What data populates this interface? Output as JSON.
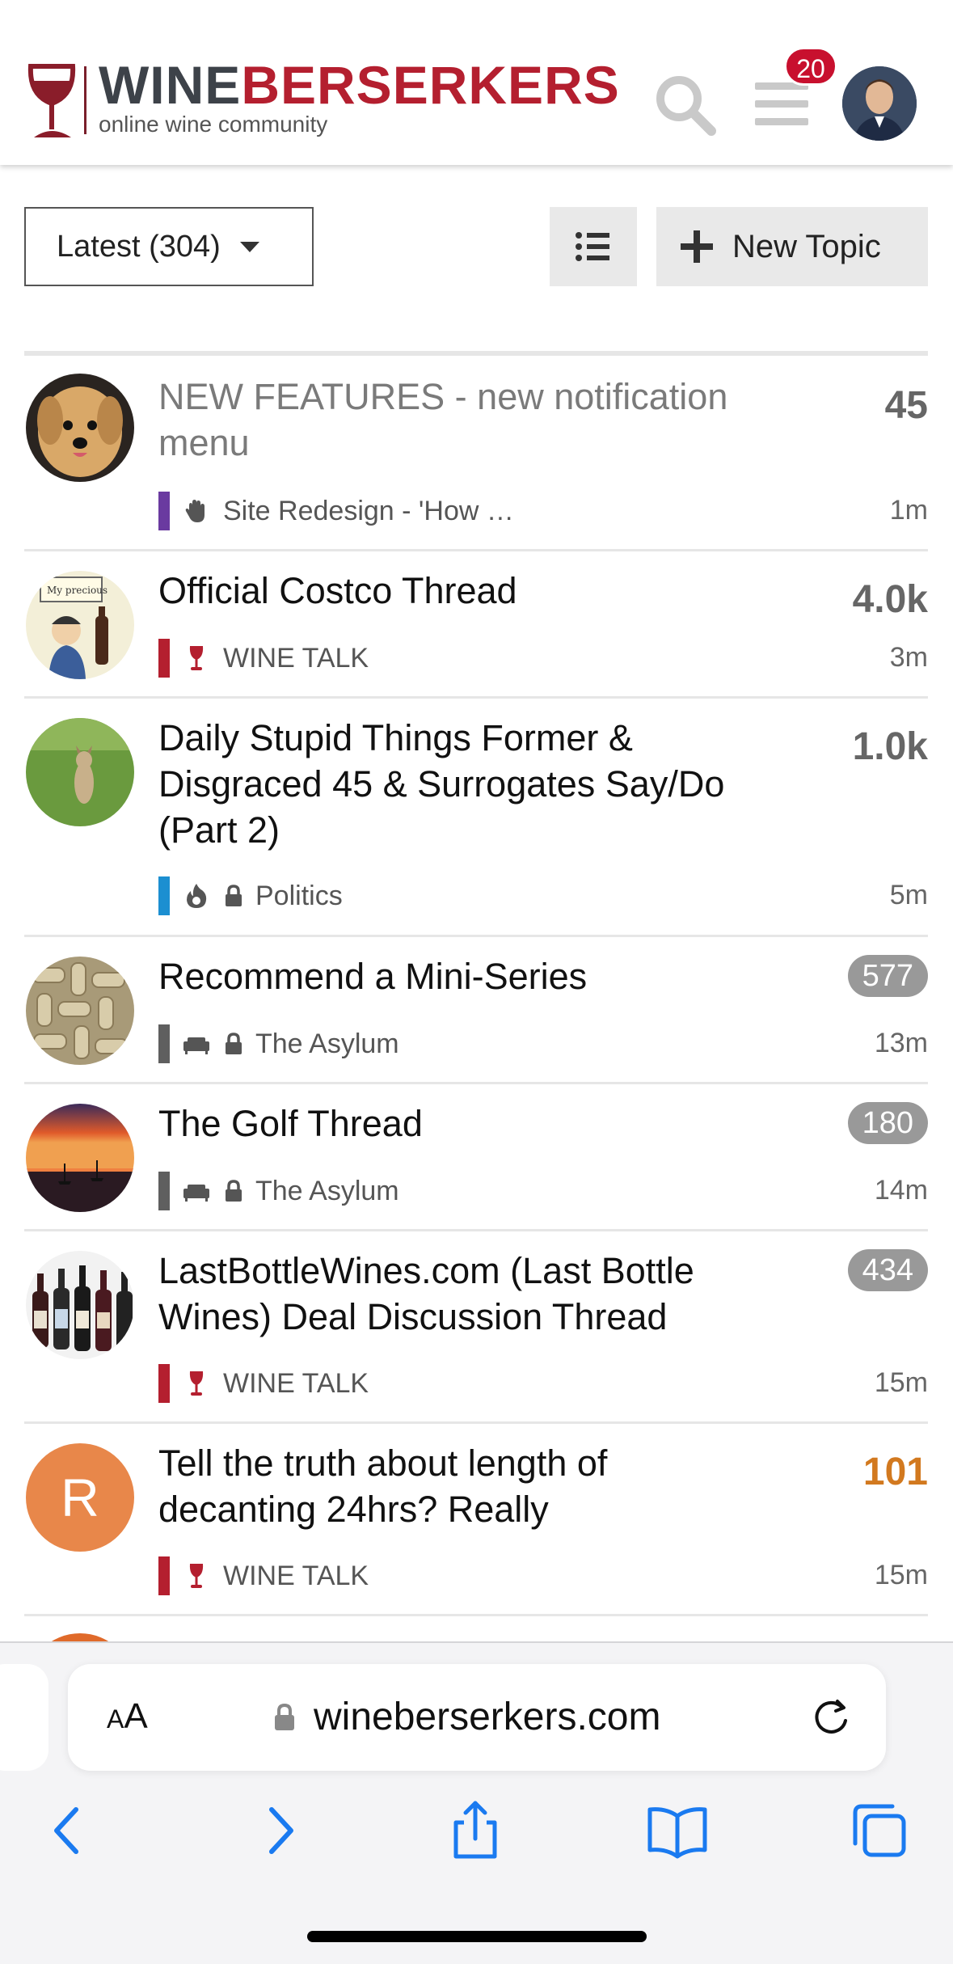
{
  "header": {
    "logo_word_1": "WINE",
    "logo_word_2": "BERSERKERS",
    "logo_tagline": "online wine community",
    "notification_count": "20",
    "brand_color": "#b41f2f"
  },
  "controls": {
    "filter_label": "Latest (304)",
    "new_topic_label": "New Topic"
  },
  "topics": [
    {
      "title": "NEW FEATURES - new notification menu",
      "category": "Site Redesign - 'How …",
      "category_color": "#6a3aa0",
      "category_icon": "hand-icon",
      "locked": false,
      "count": "45",
      "count_style": "plain",
      "time": "1m",
      "read": true
    },
    {
      "title": "Official Costco Thread",
      "category": "WINE TALK",
      "category_color": "#b41f2f",
      "category_icon": "wine-glass-icon",
      "locked": false,
      "count": "4.0k",
      "count_style": "plain",
      "time": "3m",
      "read": false
    },
    {
      "title": "Daily Stupid Things Former & Disgraced 45 & Surrogates Say/Do (Part 2)",
      "category": "Politics",
      "category_color": "#1c8fd1",
      "category_icon": "fire-icon",
      "locked": true,
      "count": "1.0k",
      "count_style": "plain",
      "time": "5m",
      "read": false
    },
    {
      "title": "Recommend a Mini-Series",
      "category": "The Asylum",
      "category_color": "#5f5f5f",
      "category_icon": "couch-icon",
      "locked": true,
      "count": "577",
      "count_style": "pill",
      "time": "13m",
      "read": false
    },
    {
      "title": "The Golf Thread",
      "category": "The Asylum",
      "category_color": "#5f5f5f",
      "category_icon": "couch-icon",
      "locked": true,
      "count": "180",
      "count_style": "pill",
      "time": "14m",
      "read": false
    },
    {
      "title": "LastBottleWines.com (Last Bottle Wines) Deal Discussion Thread",
      "category": "WINE TALK",
      "category_color": "#b41f2f",
      "category_icon": "wine-glass-icon",
      "locked": false,
      "count": "434",
      "count_style": "pill",
      "time": "15m",
      "read": false
    },
    {
      "title": "Tell the truth about length of decanting 24hrs? Really",
      "category": "WINE TALK",
      "category_color": "#b41f2f",
      "category_icon": "wine-glass-icon",
      "locked": false,
      "count": "101",
      "count_style": "hot",
      "time": "15m",
      "read": false,
      "avatar_letter": "R",
      "avatar_color": "#e8874a"
    }
  ],
  "browser": {
    "text_size_label_small": "A",
    "text_size_label_large": "A",
    "url": "wineberserkers.com"
  }
}
